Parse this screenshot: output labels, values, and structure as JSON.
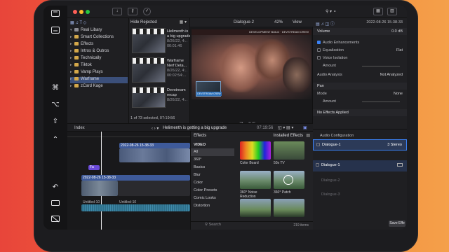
{
  "sidebar_keys": {
    "top_icon": "sidebar-toggle-icon",
    "keyboard_icon": "keyboard-icon",
    "command": "⌘",
    "option": "⌥",
    "shift": "⇧",
    "control": "⌃",
    "undo": "↶"
  },
  "toolbar": {
    "download_icon": "download-icon",
    "key_icon": "key-icon",
    "check_icon": "check-icon",
    "filter_label": "Hide Rejected",
    "project_name": "Dialogue-2",
    "zoom_label": "42%",
    "view_label": "View"
  },
  "library": {
    "title": "Real Libary",
    "items": [
      {
        "label": "Smart Collections",
        "selected": false
      },
      {
        "label": "Effects",
        "selected": false
      },
      {
        "label": "Intros & Outros",
        "selected": false
      },
      {
        "label": "Technically",
        "selected": false
      },
      {
        "label": "Tiktok",
        "selected": false
      },
      {
        "label": "Vamp Plays",
        "selected": false
      },
      {
        "label": "Warframe",
        "selected": true
      },
      {
        "label": "zCard Kage",
        "selected": false
      }
    ]
  },
  "browser": {
    "clips": [
      {
        "title": "Helimenth is a big upgrade",
        "date": "8/26/22, 4:..",
        "dur": "00:01:46"
      },
      {
        "title": "Warframe Nerf Deta...",
        "date": "8/26/22, 4:..",
        "dur": "00:02:54:..."
      },
      {
        "title": "Devstream recap",
        "date": "8/26/22, 4:..",
        "dur": ""
      }
    ],
    "status": "1 of 73 selected, 07:19:56"
  },
  "viewer": {
    "overlay_text": "DEVELOPMENT BUILD · DEVSTREAM CREW",
    "inset_label": "DEVSTREAM CREW",
    "timecode": "7:15"
  },
  "inspector": {
    "header_date": "2022-08-26 15-38-33",
    "rows": [
      {
        "label": "Volume",
        "value": "0.0 dB"
      },
      {
        "label": "Audio Enhancements",
        "value": ""
      },
      {
        "label": "Equalization",
        "value": "Flat"
      },
      {
        "label": "Voice Isolation",
        "value": ""
      },
      {
        "label": "Amount",
        "value": ""
      },
      {
        "label": "Audio Analysis",
        "value": "Not Analyzed"
      },
      {
        "label": "Pan",
        "value": ""
      },
      {
        "label": "Mode",
        "value": "None"
      },
      {
        "label": "Amount",
        "value": ""
      },
      {
        "label": "No Effects Applied",
        "value": ""
      }
    ]
  },
  "timeline": {
    "index_label": "Index",
    "project_title": "Helimenth is getting a big upgrade",
    "time_display": "07:19:56",
    "clip_label_1": "2022-08-26 15-38-33",
    "clip_label_2": "2022-08-26 15-38-33",
    "audio_label_1": "Untitled-10",
    "audio_label_2": "Untitled-10",
    "tag": "Fa"
  },
  "effects": {
    "header": "Effects",
    "installed": "Installed Effects",
    "section": "VIDEO",
    "categories": [
      "All",
      "360°",
      "Basics",
      "Blur",
      "Color",
      "Color Presets",
      "Comic Looks",
      "Distortion"
    ],
    "tiles": [
      {
        "label": "Color Board"
      },
      {
        "label": "50s TV"
      },
      {
        "label": "360° Noise Reduction"
      },
      {
        "label": "360° Patch"
      },
      {
        "label": ""
      },
      {
        "label": ""
      }
    ],
    "search_placeholder": "Search",
    "count": "219 items"
  },
  "audio": {
    "header": "Audio Configuration",
    "rows": [
      {
        "label": "Dialogue-1",
        "value": "3 Stereo"
      },
      {
        "label": "Dialogue-1",
        "value": ""
      },
      {
        "label": "Dialogue-2",
        "value": ""
      },
      {
        "label": "Dialogue-3",
        "value": ""
      }
    ],
    "save_label": "Save Effe"
  },
  "colors": {
    "accent": "#3b82f6",
    "selection": "#3b4f7a",
    "clip_blue": "#3e5a9a",
    "audio_teal": "#2e6f8a",
    "purple_tag": "#6a4ad8",
    "folder": "#d4a84a"
  }
}
